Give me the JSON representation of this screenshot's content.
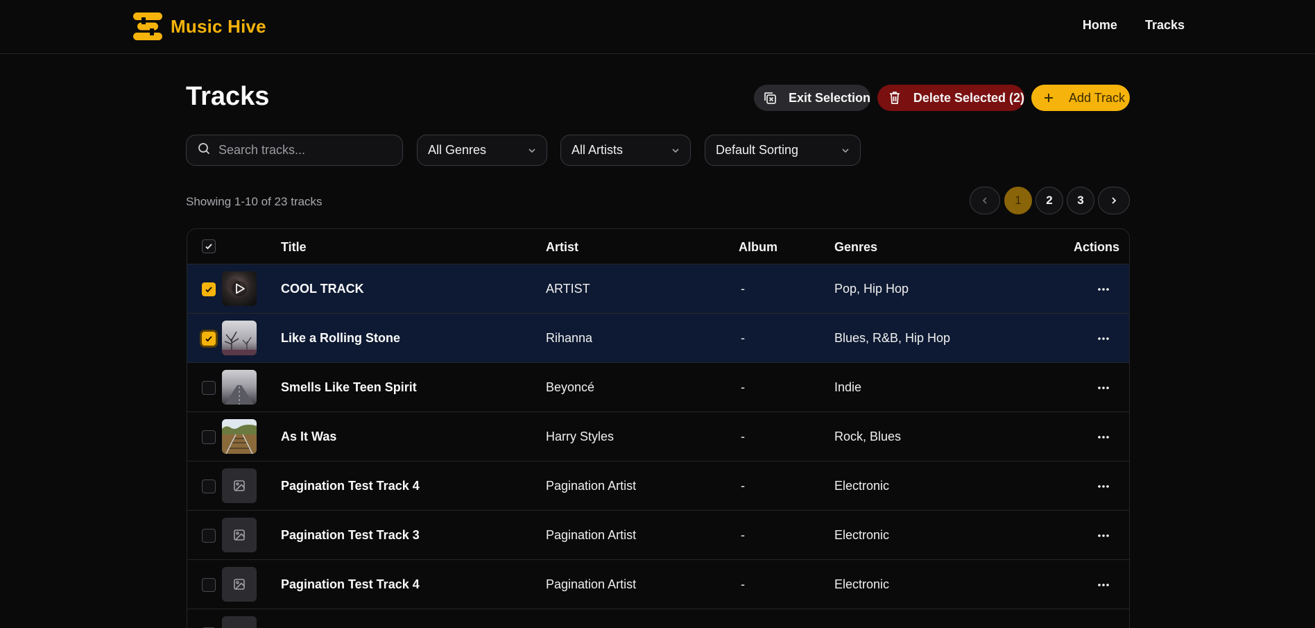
{
  "brand": {
    "name": "Music Hive"
  },
  "nav": {
    "home": "Home",
    "tracks": "Tracks"
  },
  "page": {
    "title": "Tracks"
  },
  "toolbar": {
    "exit_label": "Exit Selection",
    "delete_label": "Delete Selected (2)",
    "add_label": "Add Track"
  },
  "filters": {
    "search_placeholder": "Search tracks...",
    "search_value": "",
    "genre": "All Genres",
    "artist": "All Artists",
    "sort": "Default Sorting"
  },
  "summary": {
    "showing": "Showing 1-10 of 23 tracks"
  },
  "pagination": {
    "current": 1,
    "pages": [
      "1",
      "2",
      "3"
    ]
  },
  "table": {
    "headers": {
      "title": "Title",
      "artist": "Artist",
      "album": "Album",
      "genres": "Genres",
      "actions": "Actions"
    },
    "header_checkbox_checked": true,
    "rows": [
      {
        "selected": true,
        "thumb": "video-cover",
        "title": "COOL TRACK",
        "artist": "ARTIST",
        "album": "-",
        "genres": "Pop, Hip Hop"
      },
      {
        "selected": true,
        "thumb": "tree-cover",
        "title": "Like a Rolling Stone",
        "artist": "Rihanna",
        "album": "-",
        "genres": "Blues, R&B, Hip Hop"
      },
      {
        "selected": false,
        "thumb": "foggy-road-cover",
        "title": "Smells Like Teen Spirit",
        "artist": "Beyoncé",
        "album": "-",
        "genres": "Indie"
      },
      {
        "selected": false,
        "thumb": "rail-tracks-cover",
        "title": "As It Was",
        "artist": "Harry Styles",
        "album": "-",
        "genres": "Rock, Blues"
      },
      {
        "selected": false,
        "thumb": "image-placeholder-icon",
        "title": "Pagination Test Track 4",
        "artist": "Pagination Artist",
        "album": "-",
        "genres": "Electronic"
      },
      {
        "selected": false,
        "thumb": "image-placeholder-icon",
        "title": "Pagination Test Track 3",
        "artist": "Pagination Artist",
        "album": "-",
        "genres": "Electronic"
      },
      {
        "selected": false,
        "thumb": "image-placeholder-icon",
        "title": "Pagination Test Track 4",
        "artist": "Pagination Artist",
        "album": "-",
        "genres": "Electronic"
      }
    ]
  },
  "colors": {
    "accent": "#f5b30b",
    "danger": "#7a1010",
    "selected_row": "#0e1a33",
    "background": "#0a0a0b"
  }
}
